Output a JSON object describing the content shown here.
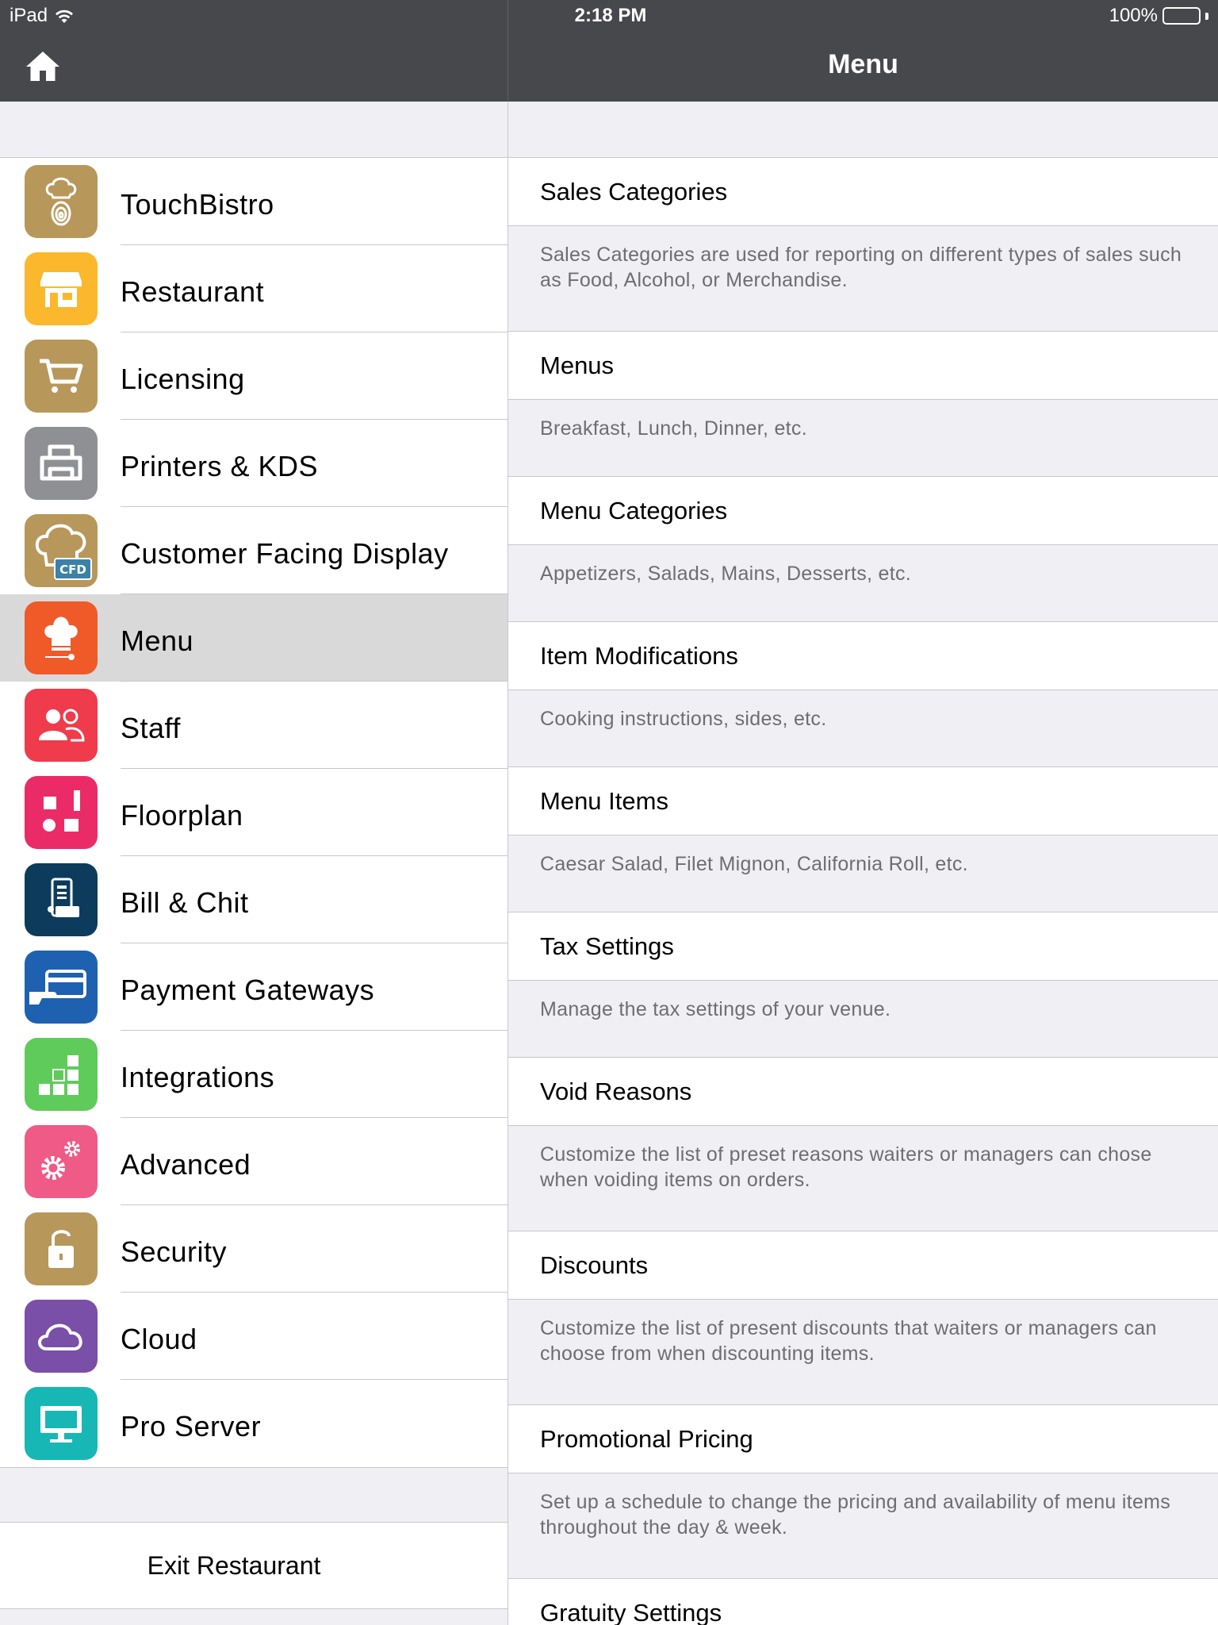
{
  "status_bar": {
    "carrier": "iPad",
    "time": "2:18 PM",
    "battery": "100%"
  },
  "header": {
    "title": "Menu"
  },
  "sidebar": {
    "items": [
      {
        "label": "TouchBistro",
        "icon": "touchbistro-logo-icon",
        "color": "#b8975a"
      },
      {
        "label": "Restaurant",
        "icon": "storefront-icon",
        "color": "#fbb82d"
      },
      {
        "label": "Licensing",
        "icon": "shopping-cart-icon",
        "color": "#b8975a"
      },
      {
        "label": "Printers & KDS",
        "icon": "printer-icon",
        "color": "#8f9094"
      },
      {
        "label": "Customer Facing Display",
        "icon": "cfd-chef-hat-icon",
        "color": "#b8975a"
      },
      {
        "label": "Menu",
        "icon": "chef-hat-icon",
        "color": "#f05a28"
      },
      {
        "label": "Staff",
        "icon": "staff-people-icon",
        "color": "#ef3b4b"
      },
      {
        "label": "Floorplan",
        "icon": "floorplan-icon",
        "color": "#eb2b67"
      },
      {
        "label": "Bill & Chit",
        "icon": "receipt-icon",
        "color": "#0d3b5c"
      },
      {
        "label": "Payment Gateways",
        "icon": "credit-card-icon",
        "color": "#1d61b0"
      },
      {
        "label": "Integrations",
        "icon": "integration-blocks-icon",
        "color": "#5fcb5a"
      },
      {
        "label": "Advanced",
        "icon": "gears-icon",
        "color": "#ef5a87"
      },
      {
        "label": "Security",
        "icon": "lock-icon",
        "color": "#b8975a"
      },
      {
        "label": "Cloud",
        "icon": "cloud-icon",
        "color": "#7a4fa8"
      },
      {
        "label": "Pro Server",
        "icon": "monitor-icon",
        "color": "#17b7b6"
      }
    ],
    "selected": "Menu",
    "exit_label": "Exit Restaurant"
  },
  "settings": [
    {
      "title": "Sales Categories",
      "description": "Sales Categories are used for reporting on different types of sales such as Food, Alcohol, or Merchandise."
    },
    {
      "title": "Menus",
      "description": "Breakfast, Lunch, Dinner, etc."
    },
    {
      "title": "Menu Categories",
      "description": "Appetizers, Salads, Mains, Desserts, etc."
    },
    {
      "title": "Item Modifications",
      "description": "Cooking instructions, sides, etc."
    },
    {
      "title": "Menu Items",
      "description": "Caesar Salad, Filet Mignon, California Roll, etc."
    },
    {
      "title": "Tax Settings",
      "description": "Manage the tax settings of your venue."
    },
    {
      "title": "Void Reasons",
      "description": "Customize the list of preset reasons waiters or managers can chose when voiding items on orders."
    },
    {
      "title": "Discounts",
      "description": "Customize the list of present discounts that waiters or managers can choose from when discounting items."
    },
    {
      "title": "Promotional Pricing",
      "description": "Set up a schedule to change the pricing and availability of menu items throughout the day & week."
    },
    {
      "title": "Gratuity Settings",
      "description": ""
    }
  ]
}
